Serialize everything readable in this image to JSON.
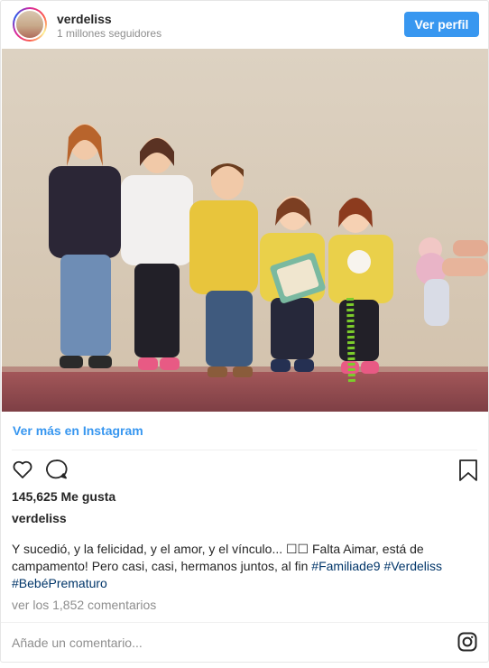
{
  "header": {
    "username": "verdeliss",
    "followers": "1 millones seguidores",
    "profile_button": "Ver perfil"
  },
  "post": {
    "more_link": "Ver más en Instagram",
    "likes": "145,625 Me gusta",
    "owner": "verdeliss",
    "caption_text": "Y sucedió, y la felicidad, y el amor, y el vínculo... ☐☐ Falta Aimar, está de campamento! Pero casi, casi, hermanos juntos, al fin ",
    "hashtags": [
      "#Familiade9",
      "#Verdeliss",
      "#BebéPrematuro"
    ],
    "view_comments": "ver los 1,852 comentarios",
    "comment_placeholder": "Añade un comentario..."
  },
  "icons": {
    "like": "heart-icon",
    "comment": "comment-icon",
    "save": "bookmark-icon",
    "instagram": "instagram-icon"
  },
  "colors": {
    "accent": "#3897f0",
    "hashtag": "#003569",
    "muted": "#8e8e8e"
  }
}
